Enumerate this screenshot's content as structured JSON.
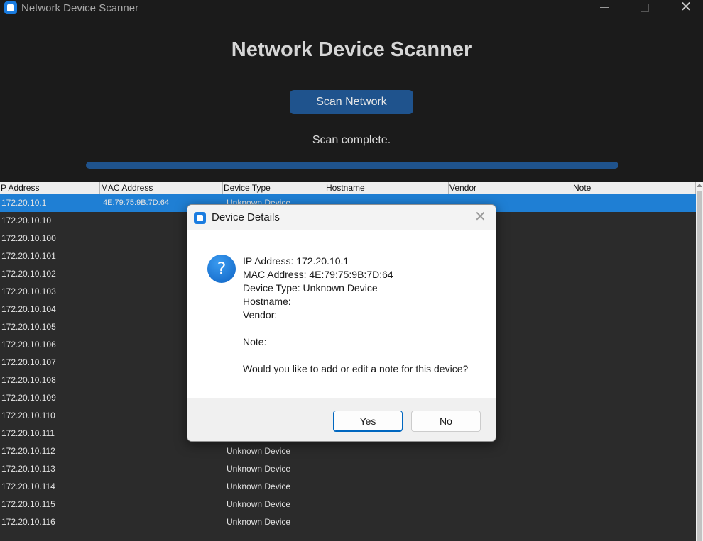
{
  "window": {
    "title": "Network Device Scanner",
    "minimize": "",
    "maximize": "",
    "close": "✕"
  },
  "app": {
    "heading": "Network Device Scanner",
    "scan_button": "Scan Network",
    "status": "Scan complete.",
    "progress": 1.0
  },
  "table": {
    "columns": [
      "P Address",
      "MAC Address",
      "Device Type",
      "Hostname",
      "Vendor",
      "Note"
    ],
    "rows": [
      {
        "ip": "172.20.10.1",
        "mac": "4E:79:75:9B:7D:64",
        "type": "Unknown Device",
        "selected": true
      },
      {
        "ip": "172.20.10.10",
        "mac": "",
        "type": ""
      },
      {
        "ip": "172.20.10.100",
        "mac": "",
        "type": ""
      },
      {
        "ip": "172.20.10.101",
        "mac": "",
        "type": ""
      },
      {
        "ip": "172.20.10.102",
        "mac": "",
        "type": ""
      },
      {
        "ip": "172.20.10.103",
        "mac": "",
        "type": ""
      },
      {
        "ip": "172.20.10.104",
        "mac": "",
        "type": ""
      },
      {
        "ip": "172.20.10.105",
        "mac": "",
        "type": ""
      },
      {
        "ip": "172.20.10.106",
        "mac": "",
        "type": ""
      },
      {
        "ip": "172.20.10.107",
        "mac": "",
        "type": ""
      },
      {
        "ip": "172.20.10.108",
        "mac": "",
        "type": ""
      },
      {
        "ip": "172.20.10.109",
        "mac": "",
        "type": ""
      },
      {
        "ip": "172.20.10.110",
        "mac": "",
        "type": ""
      },
      {
        "ip": "172.20.10.111",
        "mac": "",
        "type": ""
      },
      {
        "ip": "172.20.10.112",
        "mac": "",
        "type": "Unknown Device"
      },
      {
        "ip": "172.20.10.113",
        "mac": "",
        "type": "Unknown Device"
      },
      {
        "ip": "172.20.10.114",
        "mac": "",
        "type": "Unknown Device"
      },
      {
        "ip": "172.20.10.115",
        "mac": "",
        "type": "Unknown Device"
      },
      {
        "ip": "172.20.10.116",
        "mac": "",
        "type": "Unknown Device"
      }
    ]
  },
  "dialog": {
    "title": "Device Details",
    "close": "✕",
    "icon": "question-icon",
    "lines": [
      "IP Address: 172.20.10.1",
      "MAC Address: 4E:79:75:9B:7D:64",
      "Device Type: Unknown Device",
      "Hostname:",
      "Vendor:",
      "",
      "Note:",
      "",
      "Would you like to add or edit a note for this device?"
    ],
    "yes": "Yes",
    "no": "No"
  },
  "colors": {
    "accent": "#1f538d",
    "selection": "#1f7fd4",
    "background": "#1b1b1b"
  }
}
